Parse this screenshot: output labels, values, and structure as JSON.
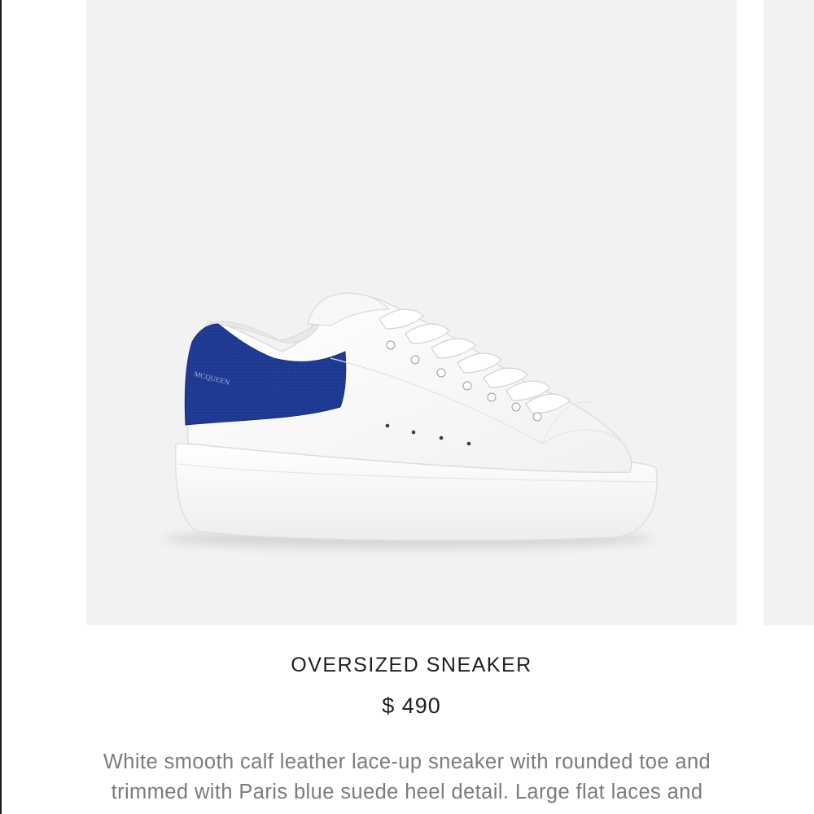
{
  "product": {
    "title": "OVERSIZED SNEAKER",
    "price": "$ 490",
    "description_lines": [
      "White smooth calf leather lace-up sneaker with rounded toe and",
      "trimmed with Paris blue suede heel detail. Large flat laces and"
    ],
    "heel_logo_text": "MCQUEEN",
    "heel_color": "#1f3a93",
    "upper_color": "#ffffff"
  },
  "gallery": {
    "image_label": "sneaker-product-image"
  }
}
